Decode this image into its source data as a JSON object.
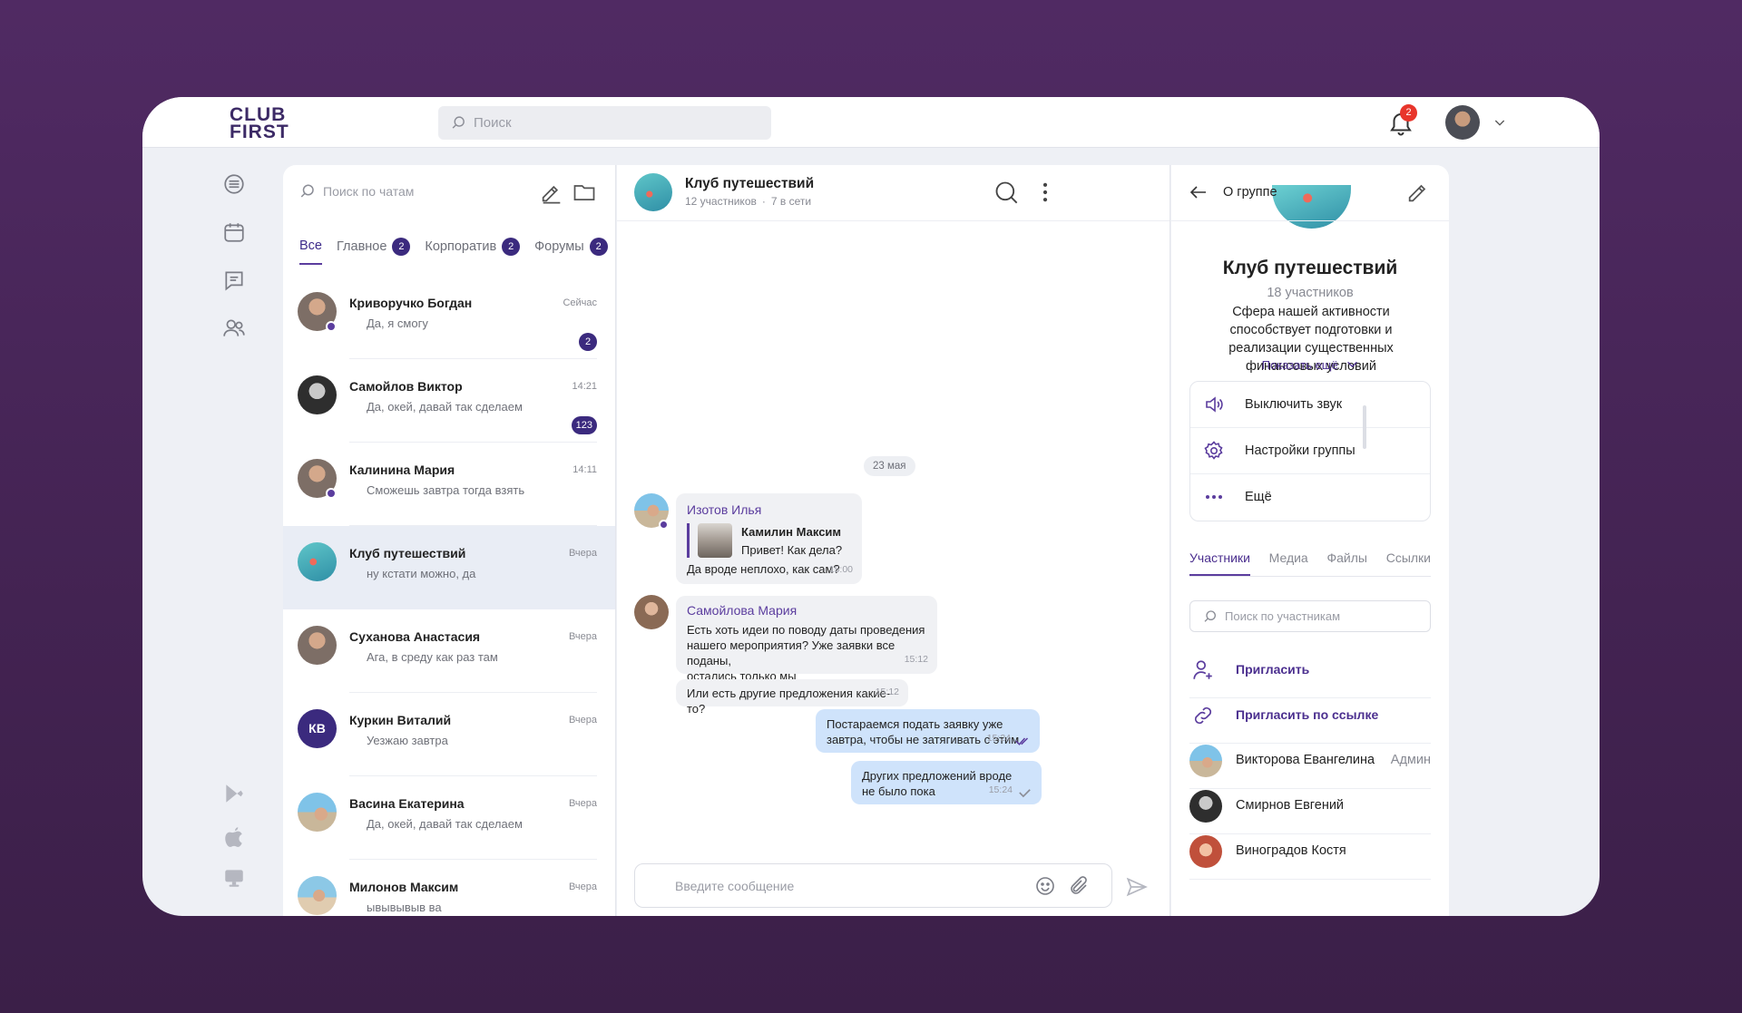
{
  "brand": {
    "logo_line1": "CLUB",
    "logo_line2": "FIRST"
  },
  "topbar": {
    "search_placeholder": "Поиск",
    "notifications_count": "2"
  },
  "chatlist": {
    "search_placeholder": "Поиск по чатам",
    "tabs": [
      {
        "label": "Все",
        "badge": ""
      },
      {
        "label": "Главное",
        "badge": "2"
      },
      {
        "label": "Корпоратив",
        "badge": "2"
      },
      {
        "label": "Форумы",
        "badge": "2"
      }
    ],
    "chats": [
      {
        "name": "Криворучко Богдан",
        "message": "Да, я смогу",
        "time": "Сейчас",
        "unread": "2"
      },
      {
        "name": "Самойлов Виктор",
        "message": "Да, окей, давай так сделаем",
        "time": "14:21",
        "unread": "123"
      },
      {
        "name": "Калинина Мария",
        "message": "Сможешь завтра тогда взять",
        "time": "14:11",
        "unread": ""
      },
      {
        "name": "Клуб путешествий",
        "message": "ну кстати можно, да",
        "time": "Вчера",
        "unread": ""
      },
      {
        "name": "Суханова Анастасия",
        "message": "Ага, в среду как раз там",
        "time": "Вчера",
        "unread": ""
      },
      {
        "name": "Куркин Виталий",
        "message": "Уезжаю завтра",
        "time": "Вчера",
        "unread": "",
        "initials": "КВ"
      },
      {
        "name": "Васина Екатерина",
        "message": "Да, окей, давай так сделаем",
        "time": "Вчера",
        "unread": ""
      },
      {
        "name": "Милонов Максим",
        "message": "ывывывыв ва",
        "time": "Вчера",
        "unread": ""
      }
    ]
  },
  "chat": {
    "title": "Клуб путешествий",
    "members": "12 участников",
    "online": "7 в сети",
    "date": "23 мая",
    "messages": [
      {
        "author": "Изотов Илья",
        "reply_name": "Камилин Максим",
        "reply_text": "Привет! Как дела?",
        "text": "Да вроде неплохо, как сам?",
        "time": "15:00"
      },
      {
        "author": "Самойлова Мария",
        "text_lines": [
          "Есть хоть идеи по поводу даты проведения",
          "нашего мероприятия? Уже заявки все поданы,",
          "остались только мы"
        ],
        "time": "15:12"
      },
      {
        "text": "Или есть другие предложения какие-то?",
        "time": "15:12"
      },
      {
        "text_lines": [
          "Постараемся подать заявку уже",
          "завтра, чтобы не затягивать с этим"
        ],
        "time": "15:24"
      },
      {
        "text_lines": [
          "Других предложений вроде",
          "не было пока"
        ],
        "time": "15:24"
      }
    ],
    "composer_placeholder": "Введите сообщение"
  },
  "info": {
    "title": "О группе",
    "group_name": "Клуб путешествий",
    "count": "18 участников",
    "description": "Сфера нашей активности способствует подготовки и реализации существенных финансовых условий",
    "show_more": "Показать ещё",
    "actions": [
      "Выключить звук",
      "Настройки группы",
      "Ещё"
    ],
    "tabs": [
      "Участники",
      "Медиа",
      "Файлы",
      "Ссылки"
    ],
    "member_search_placeholder": "Поиск по участникам",
    "invite": "Пригласить",
    "invite_link": "Пригласить по ссылке",
    "members": [
      {
        "name": "Викторова Евангелина",
        "role": "Админ"
      },
      {
        "name": "Смирнов Евгений",
        "role": ""
      },
      {
        "name": "Виноградов Костя",
        "role": ""
      }
    ]
  },
  "colors": {
    "accent": "#5b3d9e",
    "badge": "#3b2a7e",
    "notification": "#e8352b",
    "outgoing_bubble": "#cfe3fb"
  }
}
